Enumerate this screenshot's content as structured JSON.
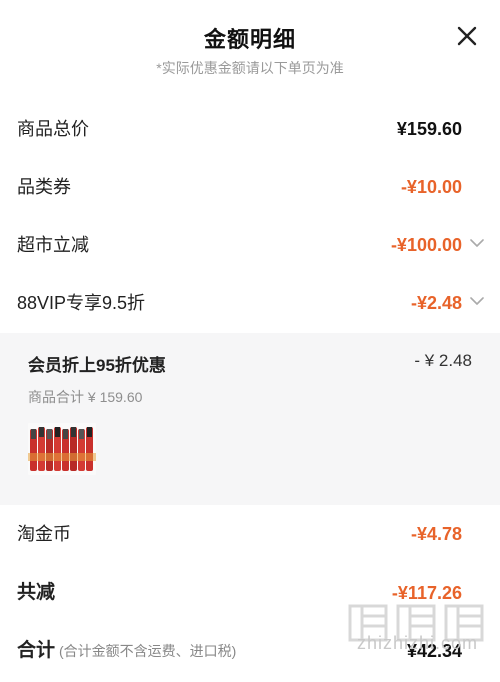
{
  "header": {
    "title": "金额明细",
    "subtitle": "*实际优惠金额请以下单页为准"
  },
  "rows": {
    "goods_total": {
      "label": "商品总价",
      "amount": "¥159.60"
    },
    "category_coupon": {
      "label": "品类券",
      "amount": "-¥10.00"
    },
    "supermarket_discount": {
      "label": "超市立减",
      "amount": "-¥100.00"
    },
    "vip_discount": {
      "label": "88VIP专享9.5折",
      "amount": "-¥2.48"
    },
    "taojinbi": {
      "label": "淘金币",
      "amount": "-¥4.78"
    },
    "total_reduction": {
      "label": "共减",
      "amount": "-¥117.26"
    },
    "grand_total": {
      "label": "合计",
      "note": "(合计金额不含运费、进口税)",
      "amount": "¥42.34"
    }
  },
  "vip_detail": {
    "title": "会员折上95折优惠",
    "amount": "- ¥ 2.48",
    "subtotal": "商品合计 ¥ 159.60"
  },
  "colors": {
    "accent": "#e8632a",
    "text": "#222222",
    "muted": "#9a9a9a",
    "panel_bg": "#f6f6f7"
  },
  "icons": {
    "close": "close-icon",
    "chevron": "chevron-down-icon"
  },
  "watermark": {
    "text": "值值值",
    "site": "zhizhizhi.com"
  }
}
